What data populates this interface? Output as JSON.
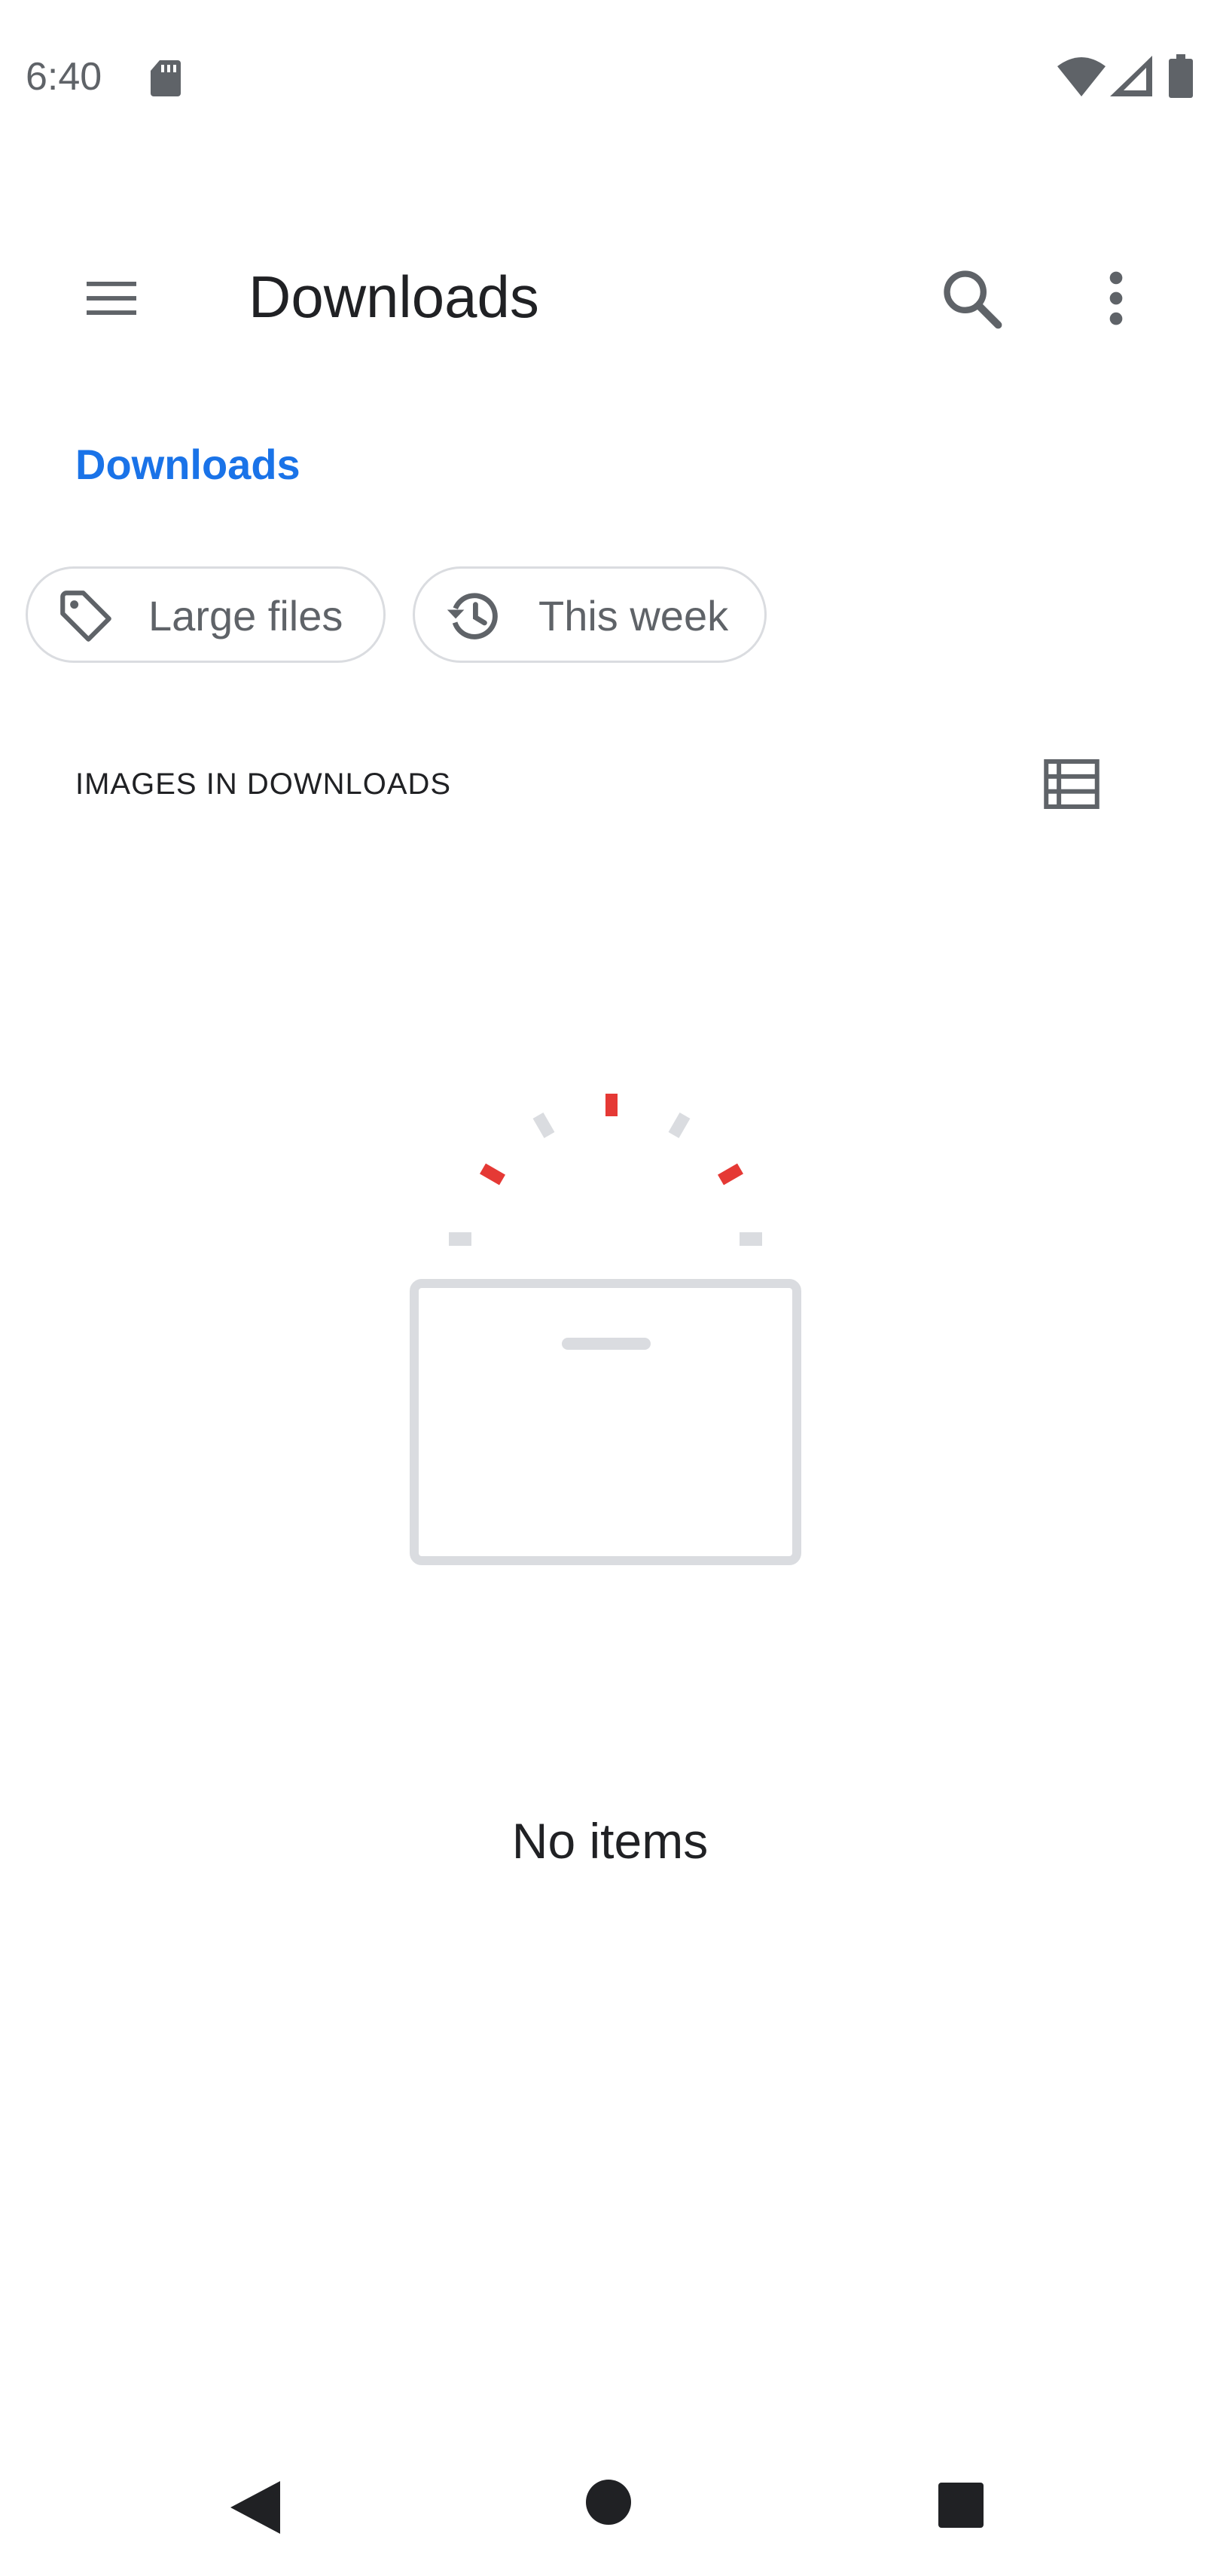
{
  "status_bar": {
    "time": "6:40",
    "icons": [
      "sd-card-icon",
      "wifi-icon",
      "signal-icon",
      "battery-icon"
    ]
  },
  "toolbar": {
    "title": "Downloads",
    "menu_icon": "menu-icon",
    "search_icon": "search-icon",
    "more_icon": "more-vert-icon"
  },
  "breadcrumb": {
    "label": "Downloads",
    "color": "#1a73e8"
  },
  "chips": [
    {
      "label": "Large files",
      "icon": "tag-icon"
    },
    {
      "label": "This week",
      "icon": "history-icon"
    }
  ],
  "section": {
    "header": "IMAGES IN DOWNLOADS",
    "view_toggle_icon": "list-view-icon"
  },
  "empty_state": {
    "message": "No items",
    "accent_color": "#e53935"
  },
  "nav_bar": {
    "icons": [
      "back-icon",
      "home-icon",
      "recents-icon"
    ]
  }
}
